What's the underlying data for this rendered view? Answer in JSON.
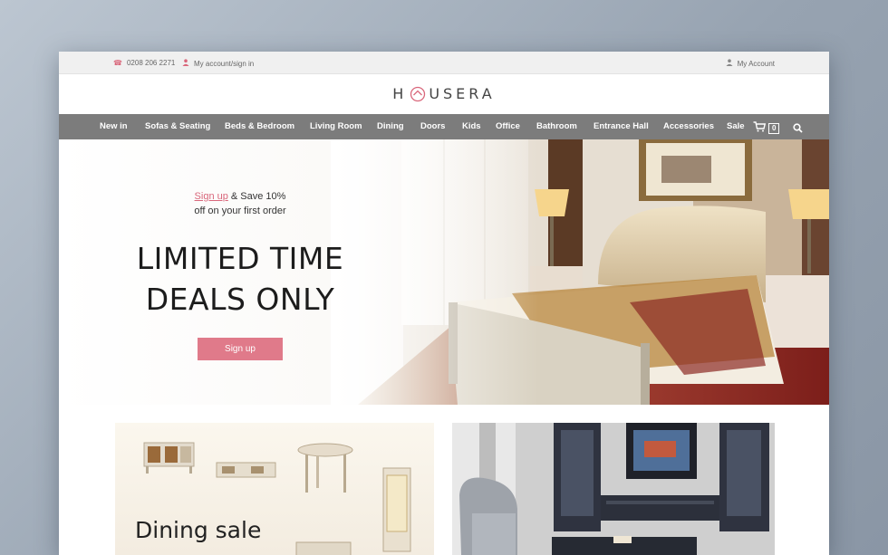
{
  "topbar": {
    "phone": "0208 206 2271",
    "account_link": "My account/sign in",
    "my_account": "My Account"
  },
  "logo": {
    "left": "H",
    "right": "USERA"
  },
  "nav": {
    "items": [
      "New in",
      "Sofas & Seating",
      "Beds & Bedroom",
      "Living Room",
      "Dining",
      "Doors",
      "Kids",
      "Office",
      "Bathroom",
      "Entrance Hall",
      "Accessories",
      "Sale"
    ],
    "cart_count": "0"
  },
  "hero": {
    "promo_link": "Sign up",
    "promo_rest": " & Save 10%",
    "promo_line2": "off on your first order",
    "headline_1": "LIMITED TIME",
    "headline_2": "DEALS ONLY",
    "button": "Sign up"
  },
  "tiles": {
    "left_title": "Dining sale"
  },
  "colors": {
    "accent": "#e07a8a",
    "nav_bg": "#7c7c7c",
    "topbar_bg": "#f0f0f0"
  },
  "icons": [
    "phone-icon",
    "user-icon",
    "cart-icon",
    "search-icon",
    "logo-house-icon"
  ]
}
